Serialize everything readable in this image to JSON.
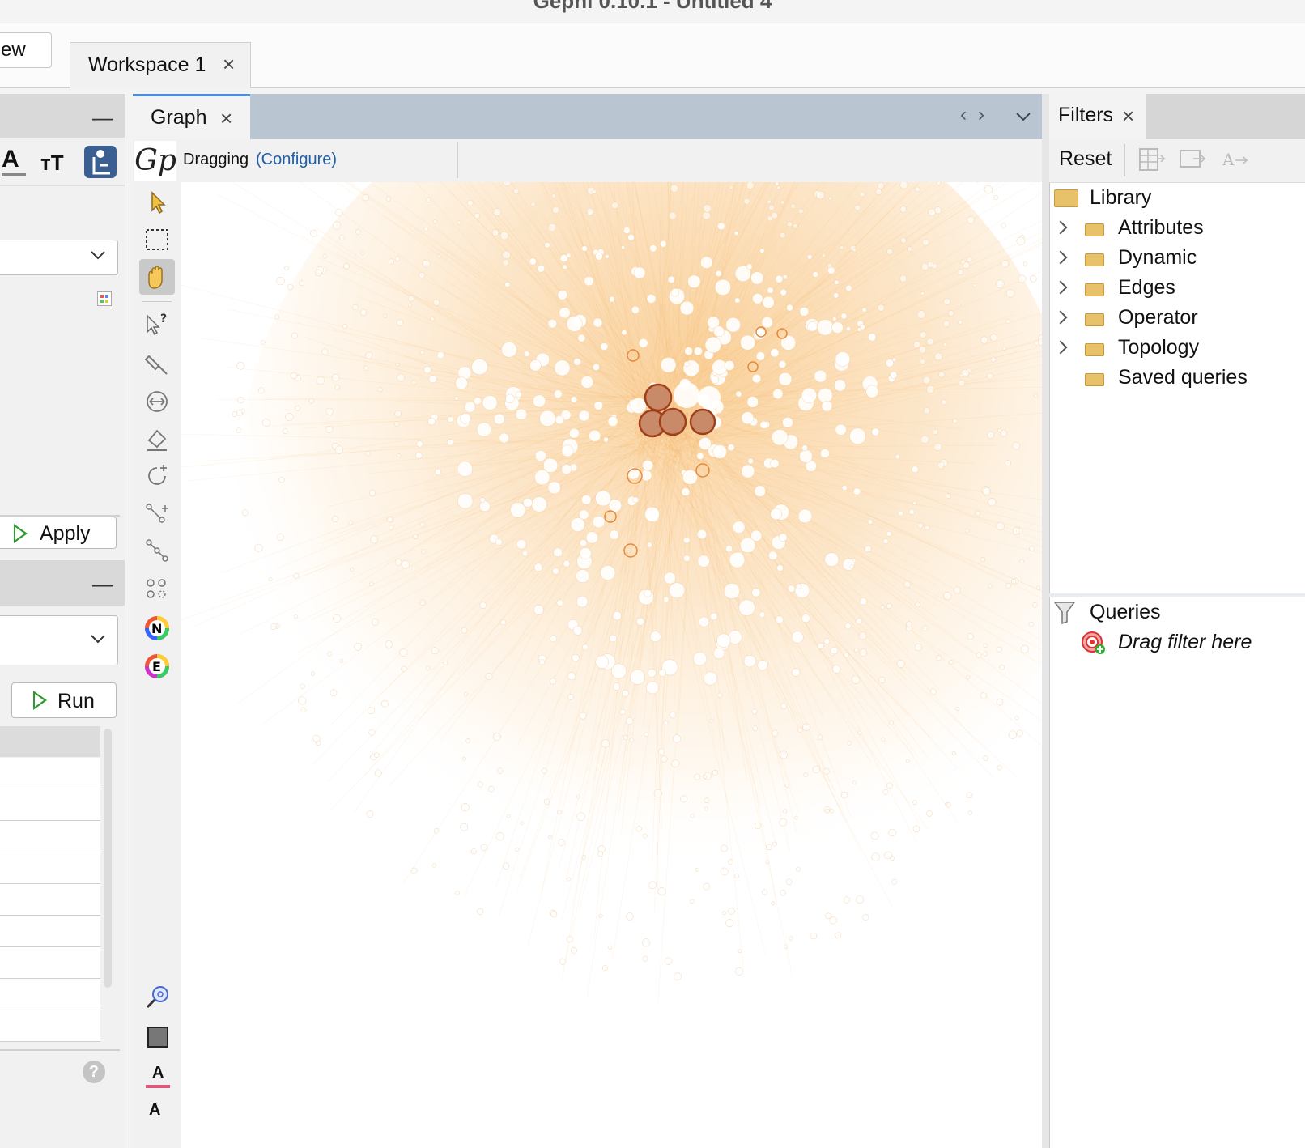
{
  "window": {
    "title": "Gephi 0.10.1 - Untitled 4"
  },
  "workspace": {
    "new_button_label": "ew",
    "tab_label": "Workspace 1",
    "tab_close": "×"
  },
  "left_panel": {
    "minimize_label": "—",
    "text_tools": {
      "font_color": "A",
      "font_size": "тТ"
    },
    "apply_label": "Apply",
    "run_label": "Run",
    "help": "?"
  },
  "graph_tab": {
    "label": "Graph",
    "close": "×",
    "nav": "‹›",
    "mode_label": "Dragging",
    "configure_label": "(Configure)",
    "logo": "Gp"
  },
  "left_toolbar_bottom": {
    "text_A1": "A",
    "text_A2": "A"
  },
  "filters": {
    "tab_label": "Filters",
    "tab_close": "×",
    "reset_label": "Reset",
    "library_label": "Library",
    "categories": [
      "Attributes",
      "Dynamic",
      "Edges",
      "Operator",
      "Topology",
      "Saved queries"
    ],
    "queries_label": "Queries",
    "drag_hint": "Drag filter here"
  },
  "colors": {
    "edge": "#f7b865",
    "node": "#ffffff",
    "hub": "#c98a6a",
    "accent_tab": "#4a90d9",
    "link": "#1f5fa8"
  }
}
